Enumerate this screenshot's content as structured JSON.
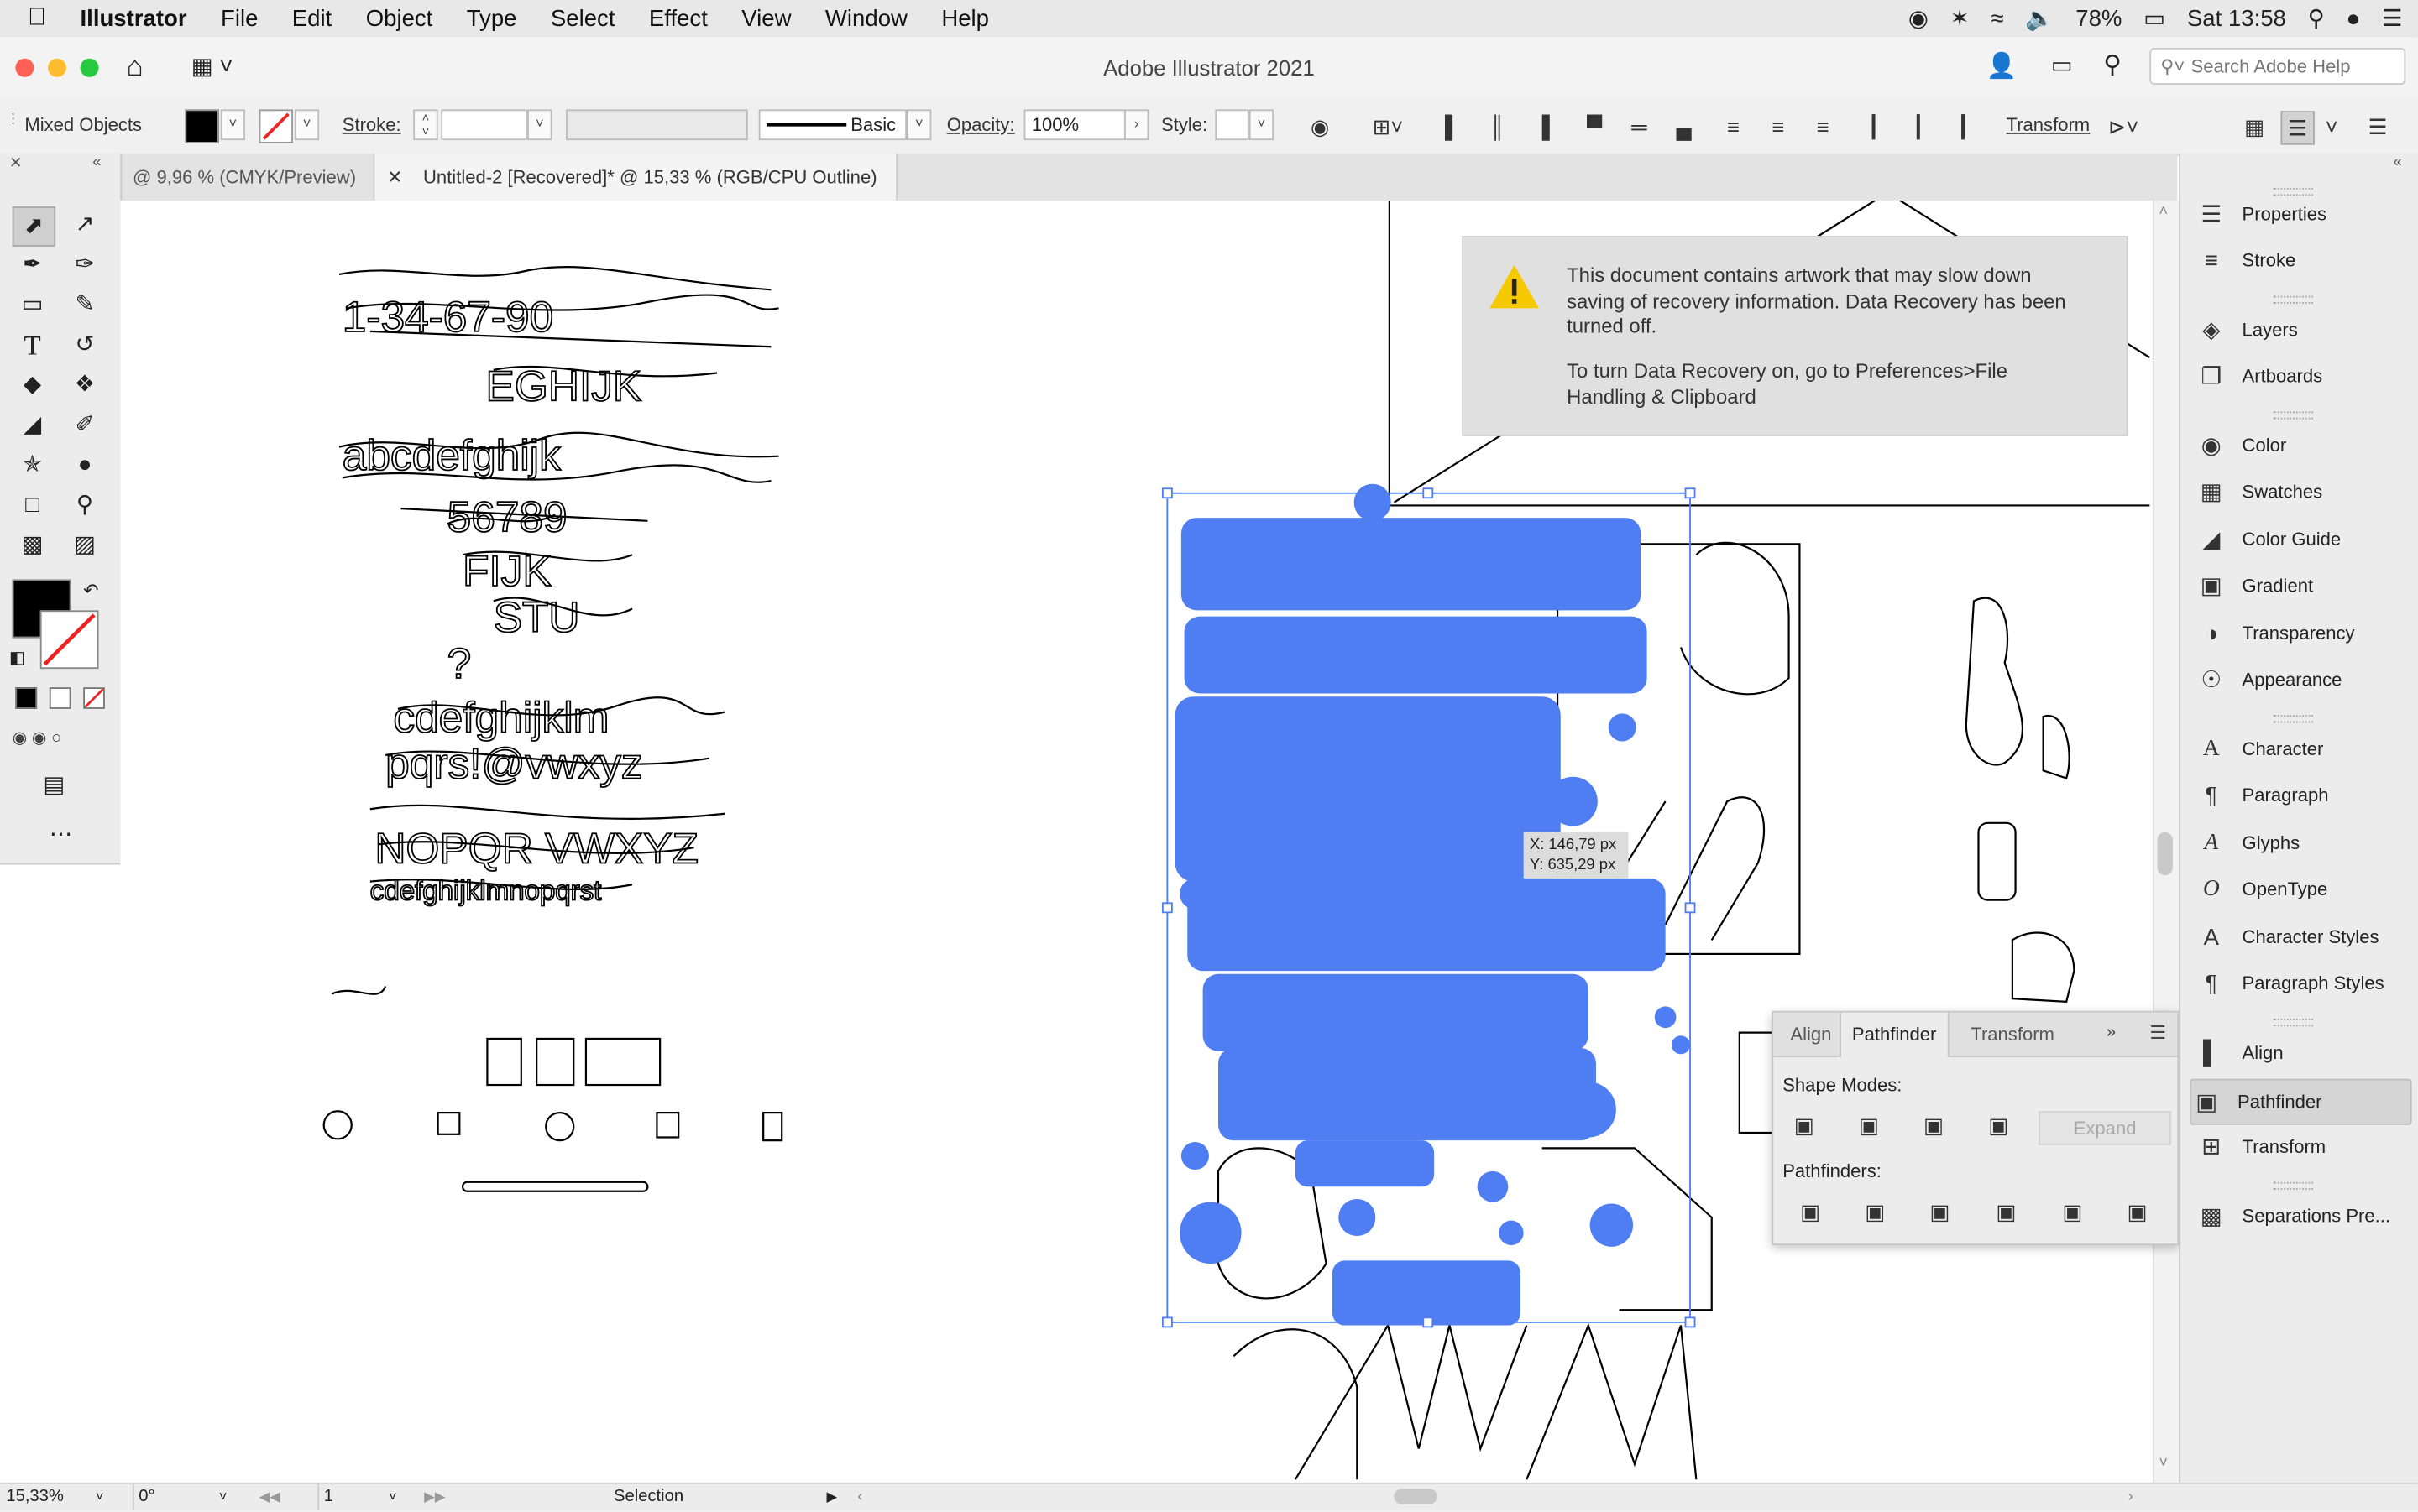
{
  "menubar": {
    "app_name": "Illustrator",
    "items": [
      "File",
      "Edit",
      "Object",
      "Type",
      "Select",
      "Effect",
      "View",
      "Window",
      "Help"
    ],
    "battery": "78%",
    "clock": "Sat 13:58"
  },
  "titlebar": {
    "title": "Adobe Illustrator 2021",
    "search_placeholder": "Search Adobe Help"
  },
  "controlbar": {
    "selection_type": "Mixed Objects",
    "stroke_label": "Stroke:",
    "brush_label": "Basic",
    "opacity_label": "Opacity:",
    "opacity_value": "100%",
    "style_label": "Style:",
    "transform_label": "Transform"
  },
  "tabs": [
    {
      "label": "@ 9,96 % (CMYK/Preview)",
      "active": false
    },
    {
      "label": "Untitled-2 [Recovered]* @ 15,33 % (RGB/CPU Outline)",
      "active": true
    }
  ],
  "notice": {
    "line1": "This document contains artwork that may slow down saving of recovery information. Data Recovery has been turned off.",
    "line2": "To turn Data Recovery on, go to Preferences>File Handling & Clipboard"
  },
  "cursor_readout": {
    "x": "X: 146,79 px",
    "y": "Y: 635,29 px"
  },
  "dock": {
    "items": [
      {
        "label": "Properties",
        "icon": "properties-icon"
      },
      {
        "label": "Stroke",
        "icon": "stroke-icon"
      },
      {
        "label": "Layers",
        "icon": "layers-icon"
      },
      {
        "label": "Artboards",
        "icon": "artboards-icon"
      },
      {
        "label": "Color",
        "icon": "color-icon"
      },
      {
        "label": "Swatches",
        "icon": "swatches-icon"
      },
      {
        "label": "Color Guide",
        "icon": "color-guide-icon"
      },
      {
        "label": "Gradient",
        "icon": "gradient-icon"
      },
      {
        "label": "Transparency",
        "icon": "transparency-icon"
      },
      {
        "label": "Appearance",
        "icon": "appearance-icon"
      },
      {
        "label": "Character",
        "icon": "character-icon"
      },
      {
        "label": "Paragraph",
        "icon": "paragraph-icon"
      },
      {
        "label": "Glyphs",
        "icon": "glyphs-icon"
      },
      {
        "label": "OpenType",
        "icon": "opentype-icon"
      },
      {
        "label": "Character Styles",
        "icon": "character-styles-icon"
      },
      {
        "label": "Paragraph Styles",
        "icon": "paragraph-styles-icon"
      },
      {
        "label": "Align",
        "icon": "align-icon"
      },
      {
        "label": "Pathfinder",
        "icon": "pathfinder-icon",
        "selected": true
      },
      {
        "label": "Transform",
        "icon": "transform-icon"
      },
      {
        "label": "Separations Pre...",
        "icon": "separations-icon"
      }
    ]
  },
  "pathfinder_panel": {
    "tabs": [
      "Align",
      "Pathfinder",
      "Transform"
    ],
    "active_tab": "Pathfinder",
    "shape_modes_label": "Shape Modes:",
    "expand_label": "Expand",
    "pathfinders_label": "Pathfinders:"
  },
  "statusbar": {
    "zoom": "15,33%",
    "rotation": "0°",
    "artboard": "1",
    "tool": "Selection"
  },
  "colors": {
    "selection_blue": "#4f7ef3",
    "fill": "#000000"
  }
}
